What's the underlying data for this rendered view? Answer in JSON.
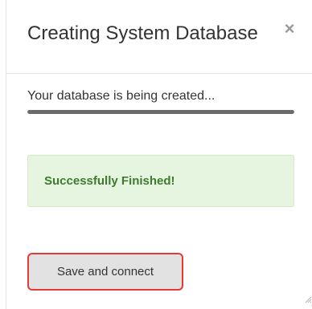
{
  "dialog": {
    "title": "Creating System Database",
    "close_glyph": "×",
    "close_icon": "close-icon"
  },
  "progress": {
    "label": "Your database is being created...",
    "percent": 100,
    "fill_color": "#6b6b6b"
  },
  "alert": {
    "message": "Successfully Finished!",
    "background": "#e6f5df",
    "text_color": "#3e7a2f"
  },
  "actions": {
    "save_label": "Save and connect",
    "highlight_color": "#e53935"
  },
  "resize_icon": "resize-grip-icon"
}
